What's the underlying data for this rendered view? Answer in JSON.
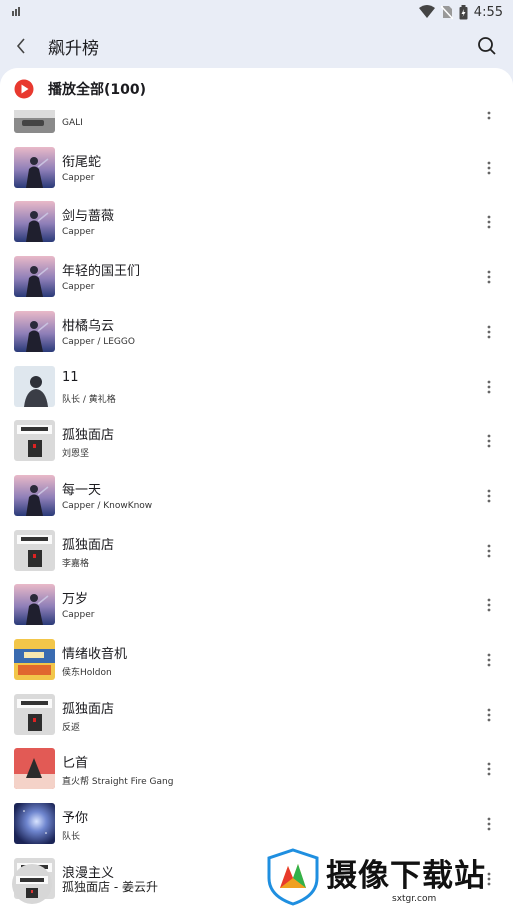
{
  "status_bar": {
    "time": "4:55",
    "icons": [
      "signal-icon",
      "wifi-icon",
      "no-sim-icon",
      "battery-icon"
    ]
  },
  "app_bar": {
    "title": "飙升榜",
    "back_icon": "chevron-left-icon",
    "search_icon": "search-icon"
  },
  "play_all": {
    "label": "播放全部(100)",
    "icon": "play-circle-icon",
    "color": "#e8392f"
  },
  "songs": [
    {
      "title": "",
      "artist": "GALI",
      "cover": "road"
    },
    {
      "title": "衔尾蛇",
      "artist": "Capper",
      "cover": "capper"
    },
    {
      "title": "剑与蔷薇",
      "artist": "Capper",
      "cover": "capper"
    },
    {
      "title": "年轻的国王们",
      "artist": "Capper",
      "cover": "capper"
    },
    {
      "title": "柑橘乌云",
      "artist": "Capper / LEGGO",
      "cover": "capper"
    },
    {
      "title": "11",
      "artist": "队长 / 黄礼格",
      "cover": "person"
    },
    {
      "title": "孤独面店",
      "artist": "刘恩坚",
      "cover": "noodle"
    },
    {
      "title": "每一天",
      "artist": "Capper / KnowKnow",
      "cover": "capper"
    },
    {
      "title": "孤独面店",
      "artist": "李嘉格",
      "cover": "noodle"
    },
    {
      "title": "万岁",
      "artist": "Capper",
      "cover": "capper"
    },
    {
      "title": "情绪收音机",
      "artist": "侯东Holdon",
      "cover": "radio"
    },
    {
      "title": "孤独面店",
      "artist": "反返",
      "cover": "noodle"
    },
    {
      "title": "匕首",
      "artist": "直火帮 Straight Fire Gang",
      "cover": "red"
    },
    {
      "title": "予你",
      "artist": "队长",
      "cover": "galaxy"
    },
    {
      "title": "浪漫主义",
      "artist": "",
      "cover": "noodle"
    }
  ],
  "mini_player": {
    "text": "孤独面店 - 姜云升"
  },
  "watermark": {
    "title": "摄像下载站",
    "url": "sxtgr.com"
  },
  "colors": {
    "background": "#e9edf6",
    "sheet": "#ffffff",
    "accent": "#e8392f"
  }
}
